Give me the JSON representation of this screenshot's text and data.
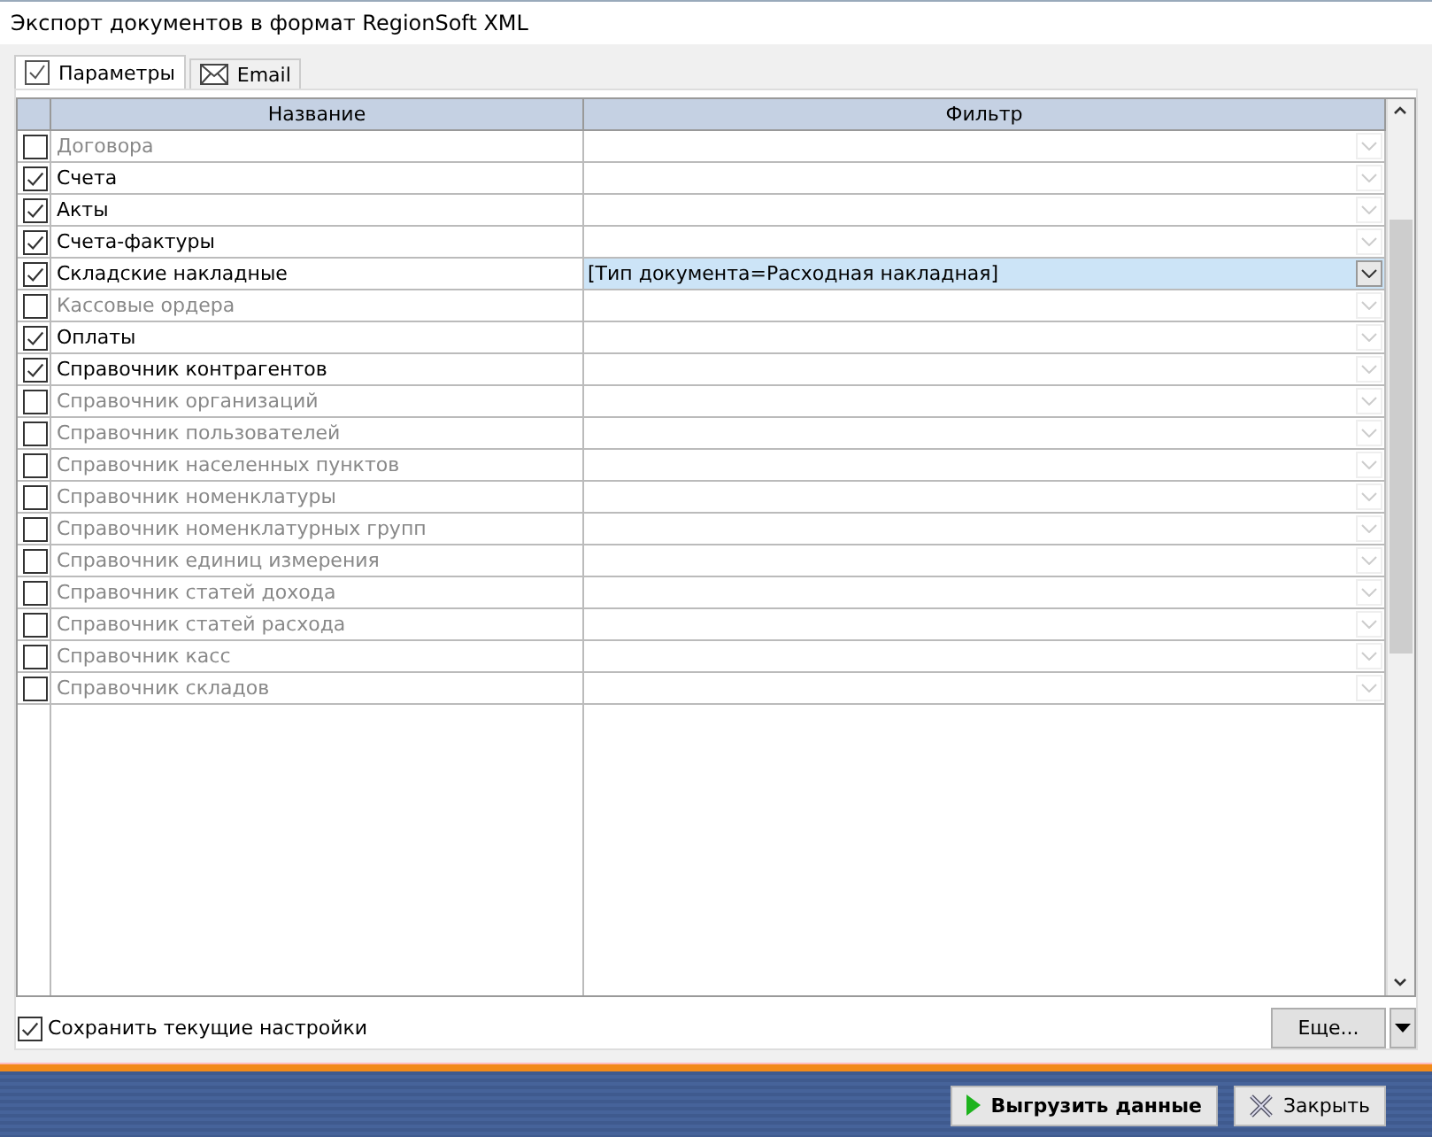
{
  "window": {
    "title": "Экспорт документов в формат RegionSoft XML"
  },
  "tabs": [
    {
      "label": "Параметры",
      "kind": "check",
      "selected": true
    },
    {
      "label": "Email",
      "kind": "mail",
      "selected": false
    }
  ],
  "table": {
    "columns": [
      "Название",
      "Фильтр"
    ],
    "rows": [
      {
        "name": "Договора",
        "checked": false,
        "selected": false
      },
      {
        "name": "Счета",
        "checked": true,
        "selected": false
      },
      {
        "name": "Акты",
        "checked": true,
        "selected": false
      },
      {
        "name": "Счета-фактуры",
        "checked": true,
        "selected": false
      },
      {
        "name": "Складские накладные",
        "checked": true,
        "selected": true,
        "filter": "[Тип документа=Расходная накладная]"
      },
      {
        "name": "Кассовые ордера",
        "checked": false,
        "selected": false
      },
      {
        "name": "Оплаты",
        "checked": true,
        "selected": false
      },
      {
        "name": "Справочник контрагентов",
        "checked": true,
        "selected": false
      },
      {
        "name": "Справочник организаций",
        "checked": false,
        "selected": false
      },
      {
        "name": "Справочник пользователей",
        "checked": false,
        "selected": false
      },
      {
        "name": "Справочник населенных пунктов",
        "checked": false,
        "selected": false
      },
      {
        "name": "Справочник номенклатуры",
        "checked": false,
        "selected": false
      },
      {
        "name": "Справочник номенклатурных групп",
        "checked": false,
        "selected": false
      },
      {
        "name": "Справочник единиц измерения",
        "checked": false,
        "selected": false
      },
      {
        "name": "Справочник статей дохода",
        "checked": false,
        "selected": false
      },
      {
        "name": "Справочник статей расхода",
        "checked": false,
        "selected": false
      },
      {
        "name": "Справочник касс",
        "checked": false,
        "selected": false
      },
      {
        "name": "Справочник складов",
        "checked": false,
        "selected": false
      }
    ]
  },
  "save_settings": {
    "label": "Сохранить текущие настройки",
    "checked": true
  },
  "more_button": "Еще...",
  "buttons": [
    {
      "label": "Выгрузить данные",
      "kind": "run"
    },
    {
      "label": "Закрыть",
      "kind": "close"
    }
  ]
}
